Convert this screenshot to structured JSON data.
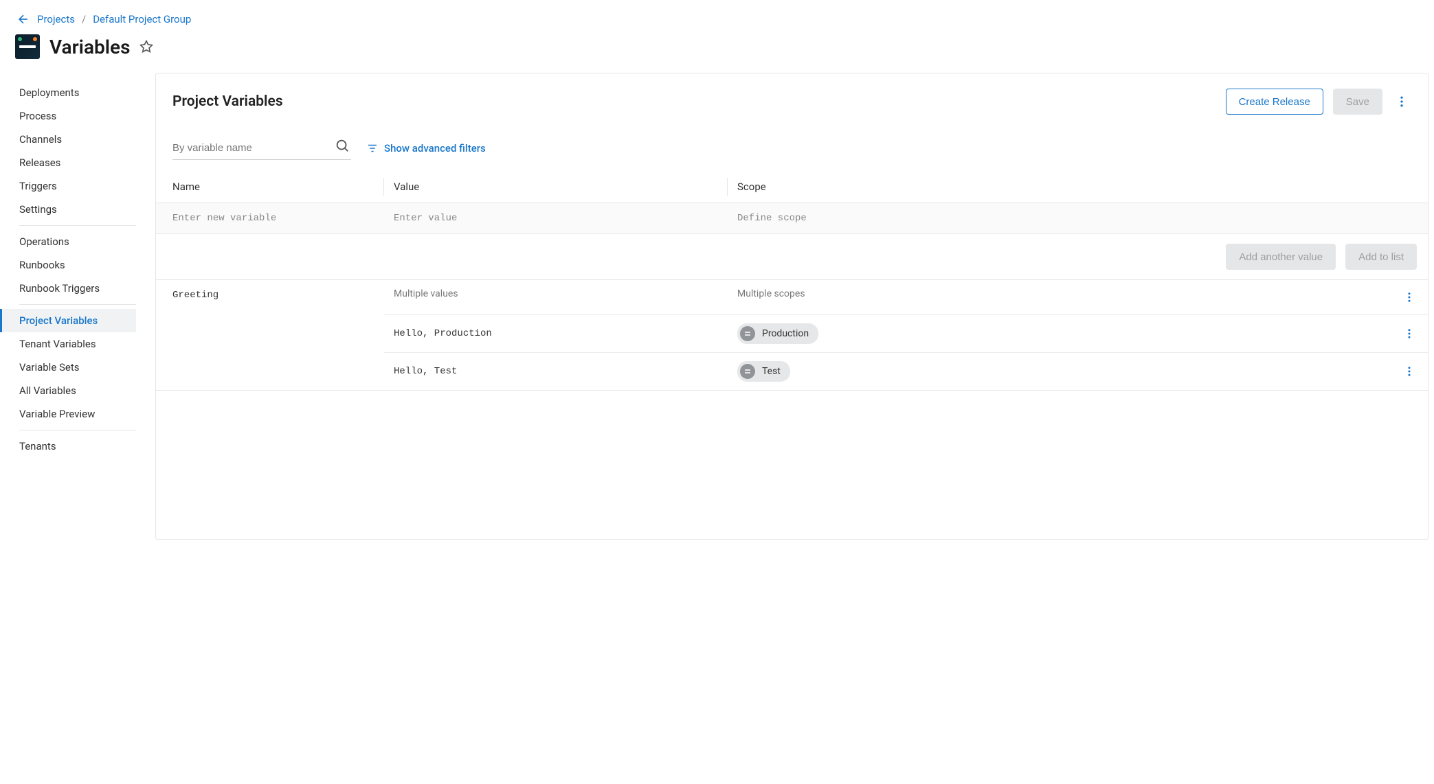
{
  "breadcrumb": {
    "projects": "Projects",
    "group": "Default Project Group"
  },
  "page_title": "Variables",
  "sidebar": {
    "groups": [
      {
        "items": [
          {
            "id": "deployments",
            "label": "Deployments",
            "active": false
          },
          {
            "id": "process",
            "label": "Process",
            "active": false
          },
          {
            "id": "channels",
            "label": "Channels",
            "active": false
          },
          {
            "id": "releases",
            "label": "Releases",
            "active": false
          },
          {
            "id": "triggers",
            "label": "Triggers",
            "active": false
          },
          {
            "id": "settings",
            "label": "Settings",
            "active": false
          }
        ]
      },
      {
        "items": [
          {
            "id": "operations",
            "label": "Operations",
            "active": false
          },
          {
            "id": "runbooks",
            "label": "Runbooks",
            "active": false
          },
          {
            "id": "runbook-triggers",
            "label": "Runbook Triggers",
            "active": false
          }
        ]
      },
      {
        "items": [
          {
            "id": "project-variables",
            "label": "Project Variables",
            "active": true
          },
          {
            "id": "tenant-variables",
            "label": "Tenant Variables",
            "active": false
          },
          {
            "id": "variable-sets",
            "label": "Variable Sets",
            "active": false
          },
          {
            "id": "all-variables",
            "label": "All Variables",
            "active": false
          },
          {
            "id": "variable-preview",
            "label": "Variable Preview",
            "active": false
          }
        ]
      },
      {
        "items": [
          {
            "id": "tenants",
            "label": "Tenants",
            "active": false
          }
        ]
      }
    ]
  },
  "header": {
    "title": "Project Variables",
    "create_release": "Create Release",
    "save": "Save"
  },
  "search": {
    "placeholder": "By variable name",
    "advanced_label": "Show advanced filters"
  },
  "columns": {
    "name": "Name",
    "value": "Value",
    "scope": "Scope"
  },
  "new_row": {
    "name_placeholder": "Enter new variable",
    "value_placeholder": "Enter value",
    "scope_placeholder": "Define scope"
  },
  "actions": {
    "add_another": "Add another value",
    "add_to_list": "Add to list"
  },
  "variables": [
    {
      "name": "Greeting",
      "multi_values_label": "Multiple values",
      "multi_scopes_label": "Multiple scopes",
      "values": [
        {
          "value": "Hello, Production",
          "scope": "Production"
        },
        {
          "value": "Hello, Test",
          "scope": "Test"
        }
      ]
    }
  ]
}
